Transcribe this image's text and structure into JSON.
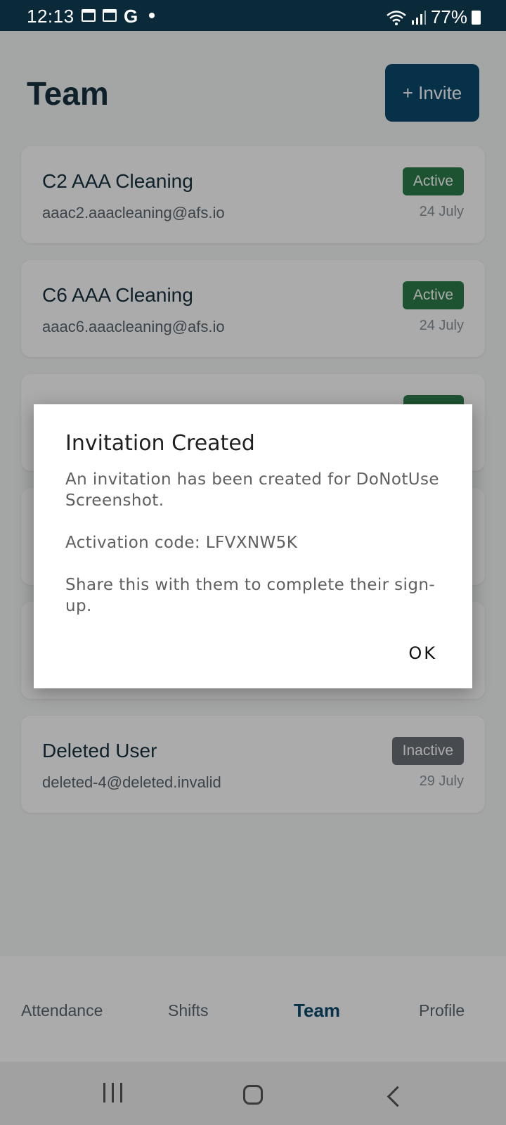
{
  "status_bar": {
    "time": "12:13",
    "battery": "77%"
  },
  "header": {
    "title": "Team",
    "invite_label": "+ Invite"
  },
  "members": [
    {
      "name": "C2 AAA Cleaning",
      "email": "aaac2.aaacleaning@afs.io",
      "status": "Active",
      "date": "24 July"
    },
    {
      "name": "C6 AAA Cleaning",
      "email": "aaac6.aaacleaning@afs.io",
      "status": "Active",
      "date": "24 July"
    },
    {
      "name": "Deleted User",
      "email": "deleted-4@deleted.invalid",
      "status": "Inactive",
      "date": "29 July"
    }
  ],
  "tabs": [
    {
      "label": "Attendance",
      "selected": false
    },
    {
      "label": "Shifts",
      "selected": false
    },
    {
      "label": "Team",
      "selected": true
    },
    {
      "label": "Profile",
      "selected": false
    }
  ],
  "dialog": {
    "title": "Invitation Created",
    "message": "An invitation has been created for DoNotUse Screenshot.",
    "code_line": "Activation code: LFVXNW5K",
    "instruction": "Share this with them to complete their sign-up.",
    "ok_label": "OK"
  },
  "colors": {
    "accent": "#0a4a6e",
    "active_badge": "#2e7d4a",
    "inactive_badge": "#6b7178",
    "status_bar": "#0a2a3a"
  },
  "icons": {
    "nav_recents": "recents-icon",
    "nav_home": "home-icon",
    "nav_back": "back-icon",
    "battery": "battery-icon",
    "wifi": "wifi-icon",
    "signal": "signal-icon"
  }
}
